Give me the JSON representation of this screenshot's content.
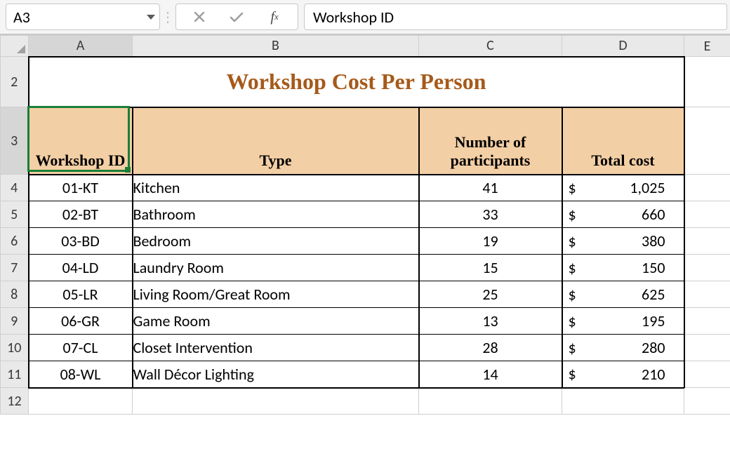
{
  "formula_bar": {
    "cell_ref": "A3",
    "formula_value": "Workshop ID"
  },
  "columns": [
    "A",
    "B",
    "C",
    "D",
    "E"
  ],
  "title_row_num": "2",
  "title": "Workshop Cost Per Person",
  "header_row_num": "3",
  "headers": {
    "id": "Workshop ID",
    "type": "Type",
    "participants": "Number of participants",
    "cost": "Total cost"
  },
  "active_cell": "A3",
  "blank_row_num": "12",
  "rows": [
    {
      "num": "4",
      "id": "01-KT",
      "type": "Kitchen",
      "participants": "41",
      "cost": "1,025"
    },
    {
      "num": "5",
      "id": "02-BT",
      "type": "Bathroom",
      "participants": "33",
      "cost": "660"
    },
    {
      "num": "6",
      "id": "03-BD",
      "type": "Bedroom",
      "participants": "19",
      "cost": "380"
    },
    {
      "num": "7",
      "id": "04-LD",
      "type": "Laundry Room",
      "participants": "15",
      "cost": "150"
    },
    {
      "num": "8",
      "id": "05-LR",
      "type": "Living Room/Great Room",
      "participants": "25",
      "cost": "625"
    },
    {
      "num": "9",
      "id": "06-GR",
      "type": "Game Room",
      "participants": "13",
      "cost": "195"
    },
    {
      "num": "10",
      "id": "07-CL",
      "type": "Closet Intervention",
      "participants": "28",
      "cost": "280"
    },
    {
      "num": "11",
      "id": "08-WL",
      "type": "Wall Décor Lighting",
      "participants": "14",
      "cost": "210"
    }
  ],
  "currency_symbol": "$"
}
